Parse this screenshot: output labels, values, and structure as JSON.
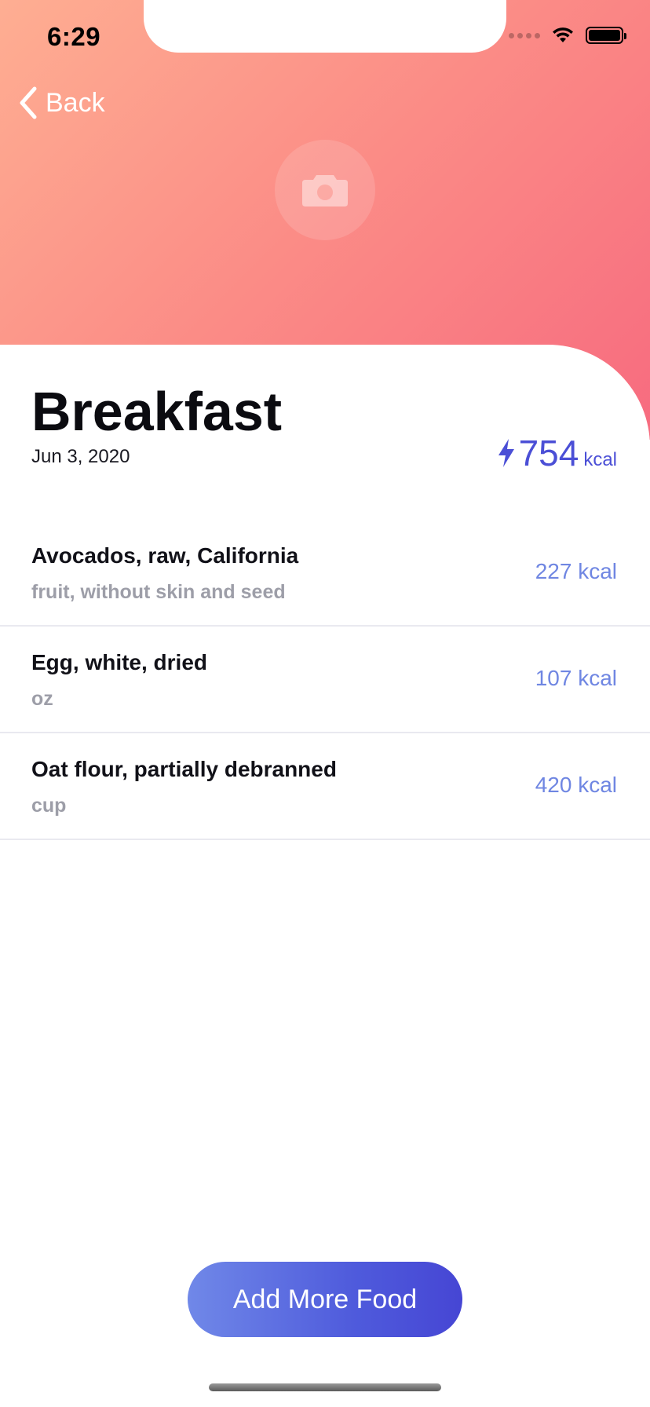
{
  "status_bar": {
    "time": "6:29"
  },
  "nav": {
    "back_label": "Back"
  },
  "meal": {
    "title": "Breakfast",
    "date": "Jun 3, 2020",
    "total_kcal": "754",
    "total_unit": "kcal"
  },
  "foods": [
    {
      "name": "Avocados, raw, California",
      "description": "fruit, without skin and seed",
      "kcal": "227 kcal"
    },
    {
      "name": "Egg, white, dried",
      "description": "oz",
      "kcal": "107 kcal"
    },
    {
      "name": "Oat flour, partially debranned",
      "description": "cup",
      "kcal": "420 kcal"
    }
  ],
  "actions": {
    "add_more_label": "Add More Food"
  },
  "colors": {
    "header_gradient_start": "#feae92",
    "header_gradient_end": "#f76b7f",
    "accent_blue": "#4b4fd6",
    "kcal_blue": "#6f86e2",
    "button_gradient_start": "#7088e8",
    "button_gradient_end": "#4646d4"
  },
  "icons": {
    "back": "chevron-left-icon",
    "camera": "camera-icon",
    "energy": "bolt-icon",
    "wifi": "wifi-icon",
    "battery": "battery-icon",
    "signal": "signal-icon"
  }
}
